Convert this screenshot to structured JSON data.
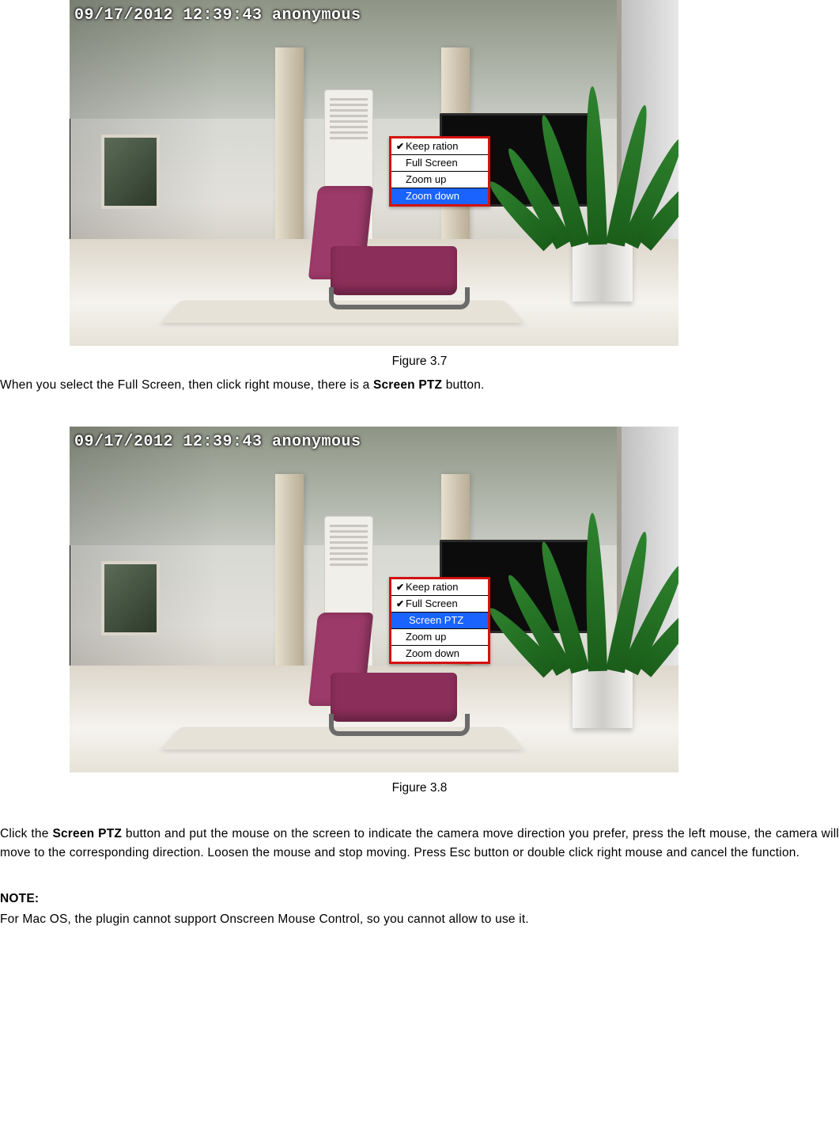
{
  "figure1": {
    "osd": "09/17/2012 12:39:43 anonymous",
    "menu": {
      "items": [
        {
          "label": "Keep ration",
          "checked": true,
          "selected": false
        },
        {
          "label": "Full Screen",
          "checked": false,
          "selected": false
        },
        {
          "label": "Zoom up",
          "checked": false,
          "selected": false
        },
        {
          "label": "Zoom down",
          "checked": false,
          "selected": true
        }
      ]
    },
    "caption": "Figure 3.7"
  },
  "para1": {
    "pre": "When you select the Full Screen, then click right mouse, there is a ",
    "bold": "Screen PTZ",
    "post": " button."
  },
  "figure2": {
    "osd": "09/17/2012 12:39:43 anonymous",
    "menu": {
      "items": [
        {
          "label": "Keep ration",
          "checked": true,
          "selected": false
        },
        {
          "label": "Full Screen",
          "checked": true,
          "selected": false
        },
        {
          "label": "Screen PTZ",
          "checked": false,
          "selected": true,
          "indent": true
        },
        {
          "label": "Zoom up",
          "checked": false,
          "selected": false
        },
        {
          "label": "Zoom down",
          "checked": false,
          "selected": false
        }
      ]
    },
    "caption": "Figure 3.8"
  },
  "para2": {
    "pre": "Click the ",
    "bold": "Screen PTZ",
    "post": " button and put the mouse on the screen to indicate the camera move direction you prefer, press the left mouse, the camera will move to the corresponding direction. Loosen the mouse and stop moving. Press Esc button or double click right mouse and cancel the function."
  },
  "note": {
    "heading": "NOTE:"
  },
  "para3": "For Mac OS, the plugin cannot support Onscreen Mouse Control, so you cannot allow to use it."
}
